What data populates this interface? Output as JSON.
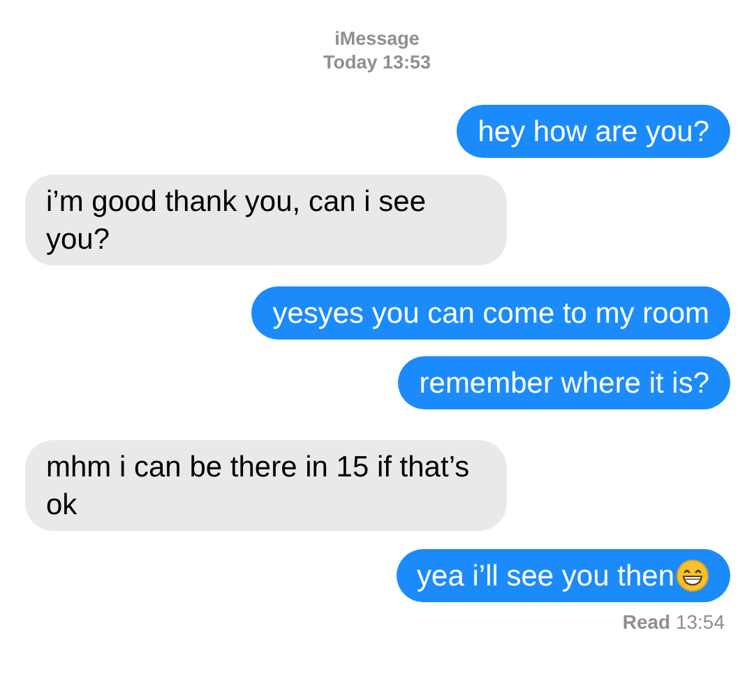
{
  "header": {
    "service": "iMessage",
    "timestamp": "Today 13:53"
  },
  "messages": [
    {
      "kind": "sent",
      "text": "hey how are you?",
      "emoji": false
    },
    {
      "kind": "received",
      "text": "i’m good thank you, can i see you?",
      "emoji": false
    },
    {
      "kind": "sent",
      "text": "yesyes you can come to my room",
      "emoji": false
    },
    {
      "kind": "sent",
      "text": "remember where it is?",
      "emoji": false
    },
    {
      "kind": "received",
      "text": "mhm i can be there in 15 if that’s ok",
      "emoji": false
    },
    {
      "kind": "sent",
      "text": "yea i’ll see you then",
      "emoji": true
    }
  ],
  "receipt": {
    "label": "Read",
    "time": "13:54"
  }
}
